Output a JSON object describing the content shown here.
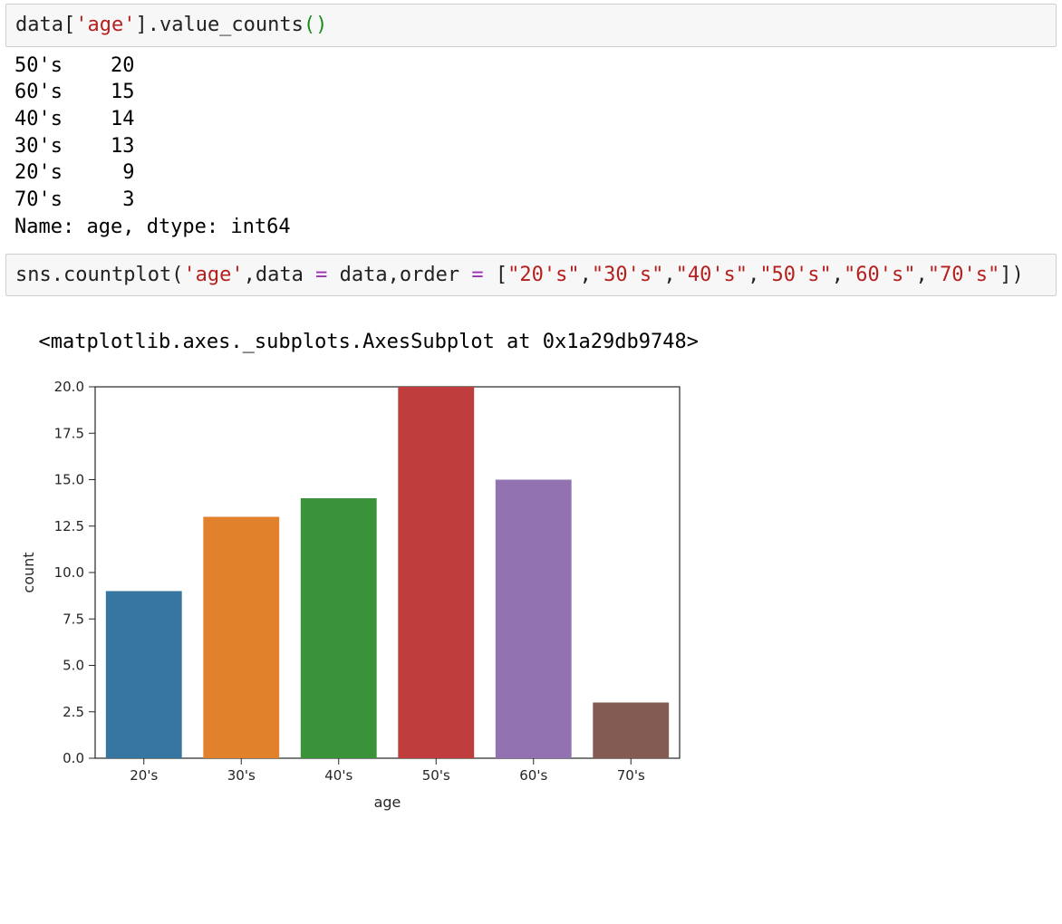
{
  "cell1": {
    "code_tokens": [
      {
        "t": "data[",
        "c": "tok-default"
      },
      {
        "t": "'age'",
        "c": "tok-str"
      },
      {
        "t": "].value_counts",
        "c": "tok-default"
      },
      {
        "t": "()",
        "c": "tok-paren"
      }
    ],
    "output_lines": [
      "50's    20",
      "60's    15",
      "40's    14",
      "30's    13",
      "20's     9",
      "70's     3",
      "Name: age, dtype: int64"
    ]
  },
  "cell2": {
    "code_tokens": [
      {
        "t": "sns.countplot(",
        "c": "tok-default"
      },
      {
        "t": "'age'",
        "c": "tok-str"
      },
      {
        "t": ",data ",
        "c": "tok-default"
      },
      {
        "t": "=",
        "c": "tok-op"
      },
      {
        "t": " data,order ",
        "c": "tok-default"
      },
      {
        "t": "=",
        "c": "tok-op"
      },
      {
        "t": " [",
        "c": "tok-default"
      },
      {
        "t": "\"20's\"",
        "c": "tok-str"
      },
      {
        "t": ",",
        "c": "tok-default"
      },
      {
        "t": "\"30's\"",
        "c": "tok-str"
      },
      {
        "t": ",",
        "c": "tok-default"
      },
      {
        "t": "\"40's\"",
        "c": "tok-str"
      },
      {
        "t": ",",
        "c": "tok-default"
      },
      {
        "t": "\"50's\"",
        "c": "tok-str"
      },
      {
        "t": ",",
        "c": "tok-default"
      },
      {
        "t": "\"60's\"",
        "c": "tok-str"
      },
      {
        "t": ",",
        "c": "tok-default"
      },
      {
        "t": "\"70's\"",
        "c": "tok-str"
      },
      {
        "t": "])",
        "c": "tok-default"
      }
    ],
    "repr_line": "<matplotlib.axes._subplots.AxesSubplot at 0x1a29db9748>"
  },
  "chart_data": {
    "type": "bar",
    "categories": [
      "20's",
      "30's",
      "40's",
      "50's",
      "60's",
      "70's"
    ],
    "values": [
      9,
      13,
      14,
      20,
      15,
      3
    ],
    "colors": [
      "#3776a1",
      "#e1812c",
      "#3a923a",
      "#c03d3e",
      "#9372b2",
      "#845b53"
    ],
    "title": "",
    "xlabel": "age",
    "ylabel": "count",
    "yticks": [
      0.0,
      2.5,
      5.0,
      7.5,
      10.0,
      12.5,
      15.0,
      17.5,
      20.0
    ],
    "ylim": [
      0,
      20
    ]
  }
}
